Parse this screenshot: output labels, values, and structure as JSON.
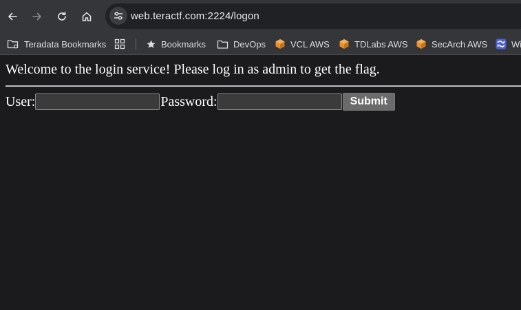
{
  "browser": {
    "url": "web.teractf.com:2224/logon",
    "nav_icons": [
      "back-arrow-icon",
      "forward-arrow-icon",
      "reload-icon",
      "home-icon"
    ],
    "bookmarks": [
      {
        "label": "Teradata Bookmarks",
        "icon": "folder-settings-icon"
      },
      {
        "label": "",
        "icon": "apps-grid-icon"
      },
      {
        "label": "Bookmarks",
        "icon": "star-icon"
      },
      {
        "label": "DevOps",
        "icon": "folder-icon"
      },
      {
        "label": "VCL AWS",
        "icon": "aws-cube-icon"
      },
      {
        "label": "TDLabs AWS",
        "icon": "aws-cube-icon"
      },
      {
        "label": "SecArch AWS",
        "icon": "aws-cube-icon"
      },
      {
        "label": "Wi",
        "icon": "confluence-icon"
      }
    ]
  },
  "page": {
    "welcome": "Welcome to the login service! Please log in as admin to get the flag.",
    "user_label": "User:",
    "user_value": "",
    "password_label": "Password:",
    "password_value": "",
    "submit_label": "Submit"
  },
  "colors": {
    "chrome_bg": "#35363a",
    "omnibox_bg": "#202124",
    "page_bg": "#1b1b1d",
    "aws_orange": "#e8912d",
    "confluence_blue": "#4b5fd6"
  }
}
